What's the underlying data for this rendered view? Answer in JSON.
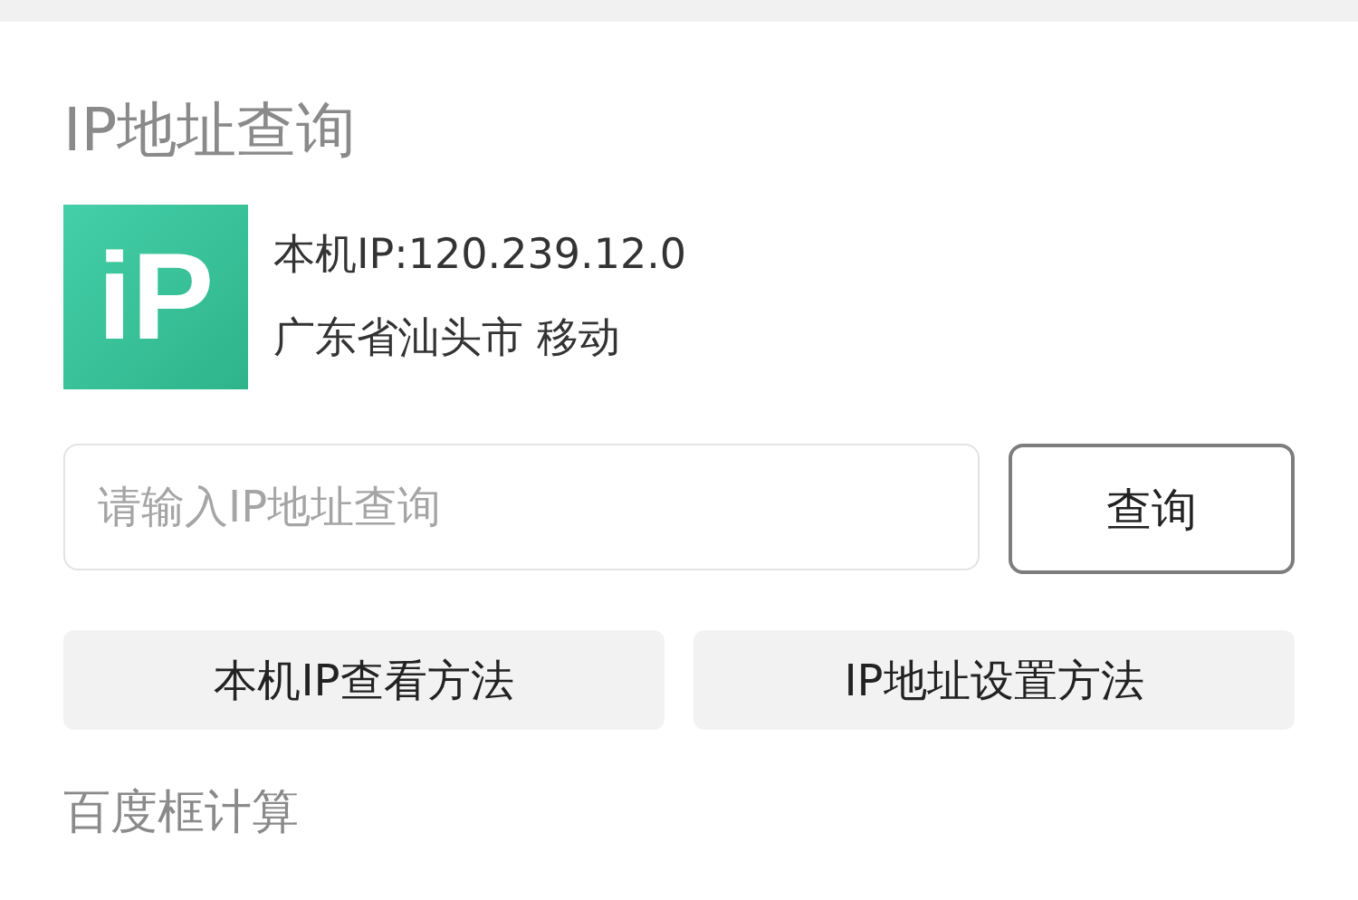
{
  "title": "IP地址查询",
  "logo": {
    "text": "iP"
  },
  "info": {
    "ip_line": "本机IP:120.239.12.0",
    "location": "广东省汕头市 移动"
  },
  "search": {
    "placeholder": "请输入IP地址查询",
    "button": "查询"
  },
  "links": [
    "本机IP查看方法",
    "IP地址设置方法"
  ],
  "footer": "百度框计算"
}
